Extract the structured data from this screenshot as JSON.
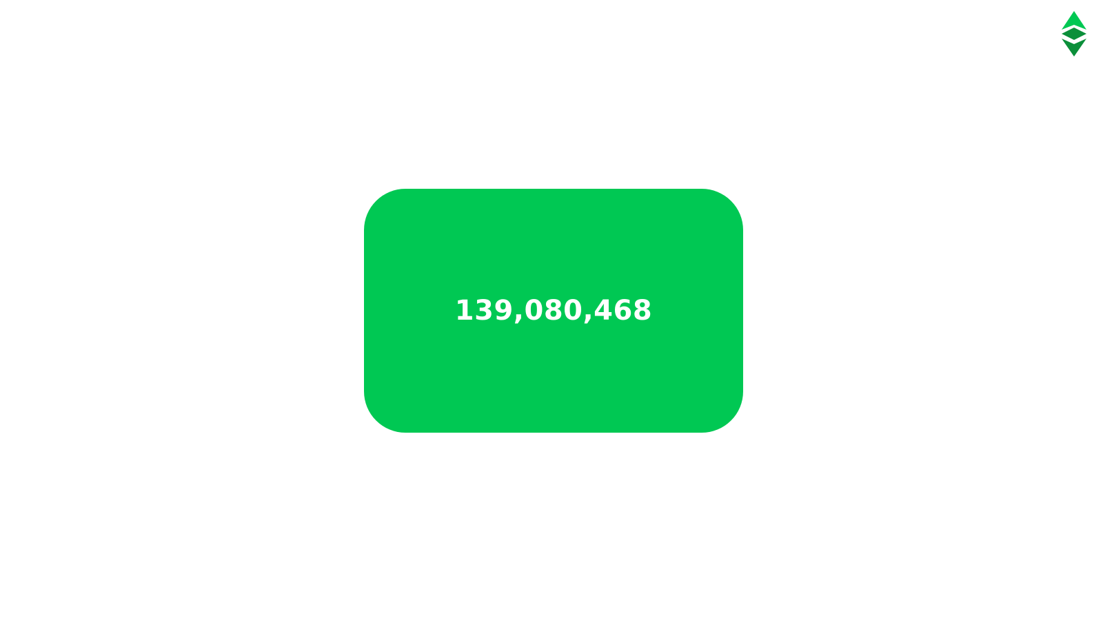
{
  "logo": {
    "icon": "ethereum-classic-icon",
    "color_light": "#00c853",
    "color_dark": "#0b8f3a"
  },
  "card": {
    "value": "139,080,468",
    "background": "#00c853",
    "text_color": "#ffffff"
  }
}
